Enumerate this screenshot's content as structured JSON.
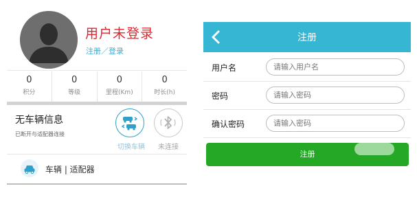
{
  "profile": {
    "title": "用户未登录",
    "links": "注册／登录",
    "avatar_icon": "person-silhouette-icon"
  },
  "stats": [
    {
      "value": "0",
      "label": "积分"
    },
    {
      "value": "0",
      "label": "等级"
    },
    {
      "value": "0",
      "label": "里程(Km)"
    },
    {
      "value": "0",
      "label": "时长(h)"
    }
  ],
  "vehicle": {
    "title": "无车辆信息",
    "status": "已断开与适配器连接",
    "switch_label": "切换车辆",
    "switch_icon": "switch-car-icon",
    "bt_label": "未连接",
    "bt_icon": "bluetooth-icon"
  },
  "adapter": {
    "label": "车辆 | 适配器",
    "icon": "car-adapter-icon"
  },
  "register": {
    "title": "注册",
    "back_icon": "chevron-left-icon",
    "fields": [
      {
        "label": "用户名",
        "placeholder": "请输入用户名"
      },
      {
        "label": "密码",
        "placeholder": "请输入密码"
      },
      {
        "label": "确认密码",
        "placeholder": "请输入密码"
      }
    ],
    "button_label": "注册"
  },
  "colors": {
    "accent_red": "#e1242e",
    "header_blue": "#37b6d3",
    "button_green": "#26a827",
    "link_blue": "#42aacf"
  }
}
